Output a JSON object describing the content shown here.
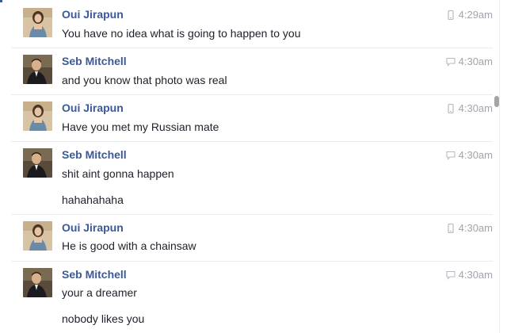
{
  "conversation": {
    "messages": [
      {
        "sender": "Oui Jirapun",
        "time": "4:29am",
        "device": "mobile-icon",
        "lines": [
          "You have no idea what is going to happen to you"
        ]
      },
      {
        "sender": "Seb Mitchell",
        "time": "4:30am",
        "device": "chat-bubble-icon",
        "lines": [
          "and you know that photo was real"
        ]
      },
      {
        "sender": "Oui Jirapun",
        "time": "4:30am",
        "device": "mobile-icon",
        "lines": [
          "Have you met my Russian mate"
        ]
      },
      {
        "sender": "Seb Mitchell",
        "time": "4:30am",
        "device": "chat-bubble-icon",
        "lines": [
          "shit aint gonna happen",
          "hahahahaha"
        ]
      },
      {
        "sender": "Oui Jirapun",
        "time": "4:30am",
        "device": "mobile-icon",
        "lines": [
          "He is good with a chainsaw"
        ]
      },
      {
        "sender": "Seb Mitchell",
        "time": "4:30am",
        "device": "chat-bubble-icon",
        "lines": [
          "your a dreamer",
          "nobody likes you"
        ]
      }
    ]
  },
  "colors": {
    "sender_name": "#3b5998",
    "message_text": "#1d2129",
    "timestamp": "#a0a4ab",
    "divider": "#e9ebee"
  }
}
